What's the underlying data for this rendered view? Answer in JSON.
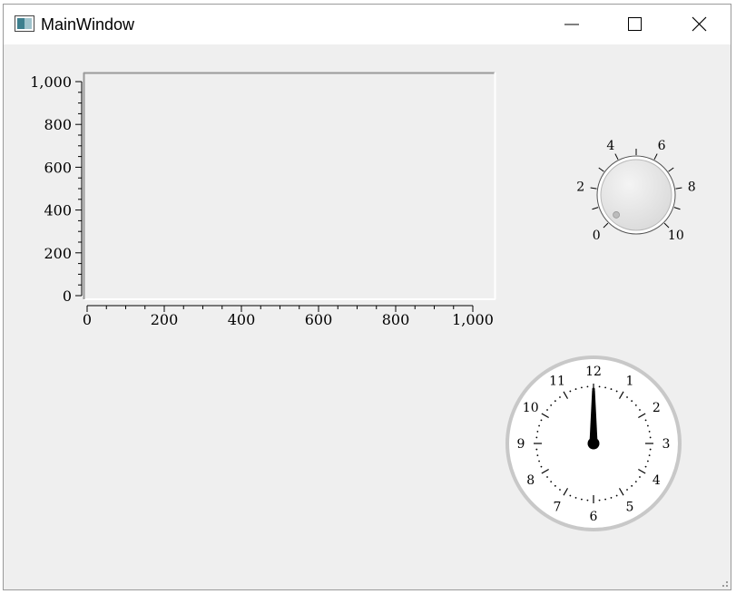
{
  "window": {
    "title": "MainWindow",
    "controls": {
      "minimize": "minimize-icon",
      "maximize": "maximize-icon",
      "close": "close-icon"
    }
  },
  "chart_data": {
    "type": "line",
    "title": "",
    "xlabel": "",
    "ylabel": "",
    "xlim": [
      0,
      1000
    ],
    "ylim": [
      0,
      1000
    ],
    "x_ticks": [
      "0",
      "200",
      "400",
      "600",
      "800",
      "1,000"
    ],
    "y_ticks": [
      "0",
      "200",
      "400",
      "600",
      "800",
      "1,000"
    ],
    "series": [],
    "grid": false
  },
  "dial": {
    "labels": [
      "0",
      "2",
      "4",
      "6",
      "8",
      "10"
    ],
    "min": 0,
    "max": 10,
    "value": 0
  },
  "clock": {
    "numbers": [
      "12",
      "1",
      "2",
      "3",
      "4",
      "5",
      "6",
      "7",
      "8",
      "9",
      "10",
      "11"
    ],
    "hour": 12,
    "minute": 0
  }
}
